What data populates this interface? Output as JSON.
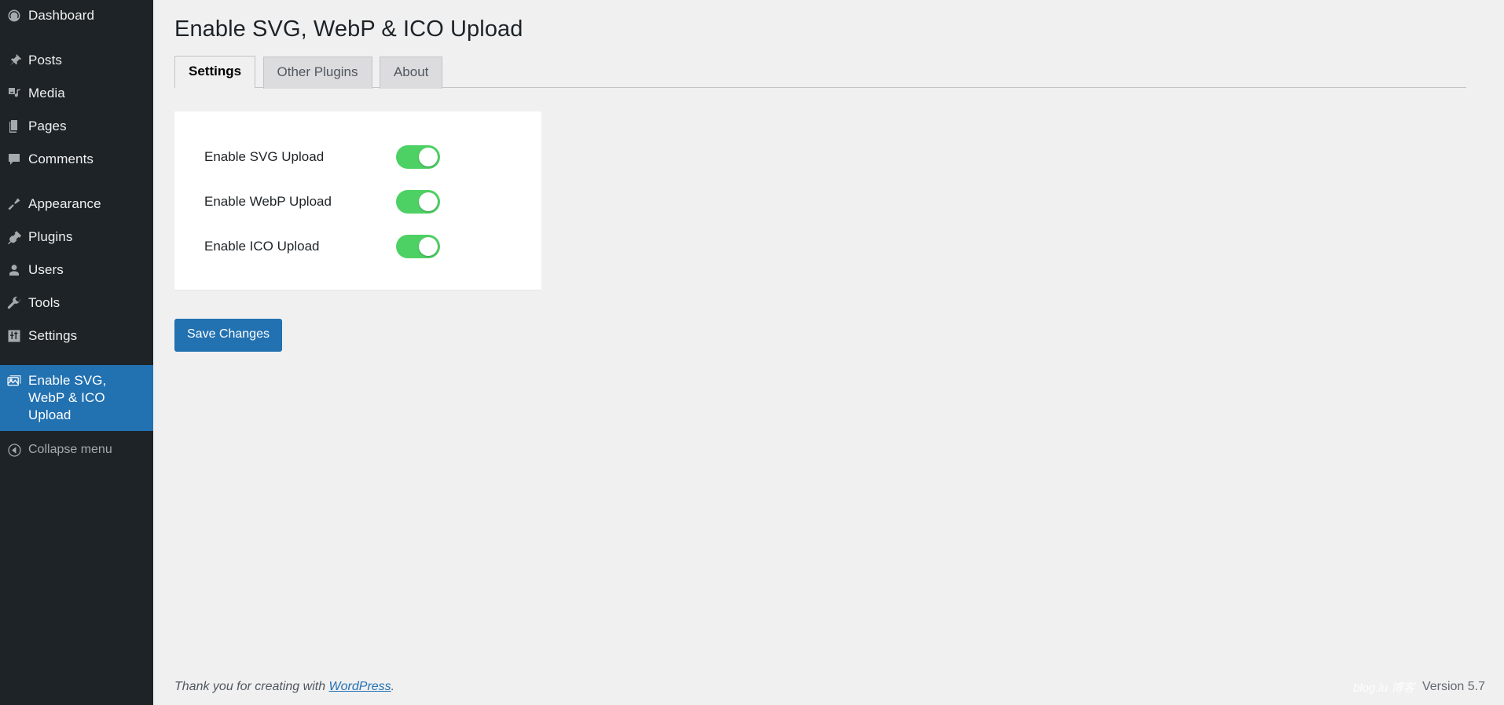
{
  "sidebar": {
    "items": [
      {
        "label": "Dashboard",
        "icon": "dashboard-icon",
        "current": false,
        "sep_after": true
      },
      {
        "label": "Posts",
        "icon": "pin-icon",
        "current": false,
        "sep_after": false
      },
      {
        "label": "Media",
        "icon": "media-icon",
        "current": false,
        "sep_after": false
      },
      {
        "label": "Pages",
        "icon": "pages-icon",
        "current": false,
        "sep_after": false
      },
      {
        "label": "Comments",
        "icon": "comments-icon",
        "current": false,
        "sep_after": true
      },
      {
        "label": "Appearance",
        "icon": "paintbrush-icon",
        "current": false,
        "sep_after": false
      },
      {
        "label": "Plugins",
        "icon": "plug-icon",
        "current": false,
        "sep_after": false
      },
      {
        "label": "Users",
        "icon": "user-icon",
        "current": false,
        "sep_after": false
      },
      {
        "label": "Tools",
        "icon": "wrench-icon",
        "current": false,
        "sep_after": false
      },
      {
        "label": "Settings",
        "icon": "sliders-icon",
        "current": false,
        "sep_after": true
      },
      {
        "label": "Enable SVG, WebP & ICO Upload",
        "icon": "images-icon",
        "current": true,
        "sep_after": false
      }
    ],
    "collapse": {
      "label": "Collapse menu",
      "icon": "collapse-arrow-icon"
    }
  },
  "header": {
    "title": "Enable SVG, WebP & ICO Upload"
  },
  "tabs": [
    {
      "label": "Settings",
      "active": true
    },
    {
      "label": "Other Plugins",
      "active": false
    },
    {
      "label": "About",
      "active": false
    }
  ],
  "settings": {
    "rows": [
      {
        "label": "Enable SVG Upload",
        "enabled": true
      },
      {
        "label": "Enable WebP Upload",
        "enabled": true
      },
      {
        "label": "Enable ICO Upload",
        "enabled": true
      }
    ],
    "save_label": "Save Changes"
  },
  "footer": {
    "thanks_prefix": "Thank you for creating with ",
    "wordpress_link": "WordPress",
    "thanks_suffix": ".",
    "version": "Version 5.7",
    "watermark": "blog.lu          博客"
  },
  "colors": {
    "sidebar_bg": "#1d2327",
    "accent_blue": "#2271b1",
    "toggle_on": "#4ed164",
    "content_bg": "#f0f0f1"
  }
}
